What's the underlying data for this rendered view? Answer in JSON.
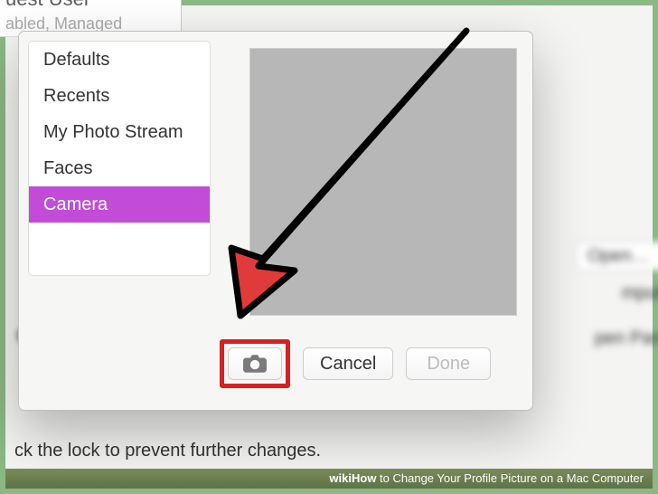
{
  "background": {
    "user_list_title": "uest User",
    "user_list_sub": "abled, Managed",
    "open_button": "Open…",
    "partial_mputer": "mputer",
    "partial_parental": "pen Parenta",
    "lock_text": "ck the lock to prevent further changes."
  },
  "popover": {
    "sources": [
      {
        "label": "Defaults",
        "selected": false
      },
      {
        "label": "Recents",
        "selected": false
      },
      {
        "label": "My Photo Stream",
        "selected": false
      },
      {
        "label": "Faces",
        "selected": false
      },
      {
        "label": "Camera",
        "selected": true
      }
    ],
    "buttons": {
      "cancel": "Cancel",
      "done": "Done"
    }
  },
  "caption": {
    "brand": "wiki",
    "how": "How",
    "title": " to Change Your Profile Picture on a Mac Computer"
  },
  "colors": {
    "highlight_red": "#d62024",
    "selection_purple": "#c24cd8",
    "frame_green": "#8bb885"
  }
}
